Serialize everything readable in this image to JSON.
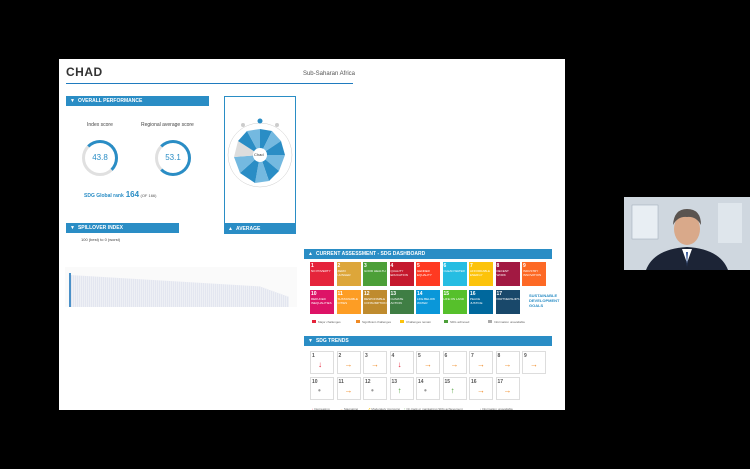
{
  "slide": {
    "country": "CHAD",
    "region": "Sub-Saharan Africa",
    "overall": {
      "header": "OVERALL PERFORMANCE",
      "index_label": "Index score",
      "index_value": "43.8",
      "index_fraction": 0.438,
      "regional_label": "Regional average score",
      "regional_value": "53.1",
      "regional_fraction": 0.531,
      "rank_label": "SDG Global rank",
      "rank_value": "164",
      "rank_of": "(OF 166)"
    },
    "radar": {
      "header": "AVERAGE PERFORMANCE BY SDG",
      "center": "Chad"
    },
    "spillover": {
      "header": "SPILLOVER INDEX",
      "subtitle": "100 (best) to 0 (worst)"
    },
    "dashboard": {
      "header": "CURRENT ASSESSMENT - SDG DASHBOARD",
      "tiles": [
        {
          "n": "1",
          "name": "NO POVERTY",
          "color": "#e5243b"
        },
        {
          "n": "2",
          "name": "ZERO HUNGER",
          "color": "#dda63a"
        },
        {
          "n": "3",
          "name": "GOOD HEALTH",
          "color": "#4c9f38"
        },
        {
          "n": "4",
          "name": "QUALITY EDUCATION",
          "color": "#c5192d"
        },
        {
          "n": "5",
          "name": "GENDER EQUALITY",
          "color": "#ff3a21"
        },
        {
          "n": "6",
          "name": "CLEAN WATER",
          "color": "#26bde2"
        },
        {
          "n": "7",
          "name": "AFFORDABLE ENERGY",
          "color": "#fcc30b"
        },
        {
          "n": "8",
          "name": "DECENT WORK",
          "color": "#a21942"
        },
        {
          "n": "9",
          "name": "INDUSTRY INNOVATION",
          "color": "#fd6925"
        },
        {
          "n": "10",
          "name": "REDUCED INEQUALITIES",
          "color": "#dd1367"
        },
        {
          "n": "11",
          "name": "SUSTAINABLE CITIES",
          "color": "#fd9d24"
        },
        {
          "n": "12",
          "name": "RESPONSIBLE CONSUMPTION",
          "color": "#bf8b2e"
        },
        {
          "n": "13",
          "name": "CLIMATE ACTION",
          "color": "#3f7e44"
        },
        {
          "n": "14",
          "name": "LIFE BELOW WATER",
          "color": "#0a97d9"
        },
        {
          "n": "15",
          "name": "LIFE ON LAND",
          "color": "#56c02b"
        },
        {
          "n": "16",
          "name": "PEACE JUSTICE",
          "color": "#00689d"
        },
        {
          "n": "17",
          "name": "PARTNERSHIPS",
          "color": "#19486a"
        }
      ],
      "goals_logo": "SUSTAINABLE DEVELOPMENT GOALS",
      "legend": [
        "Major challenges",
        "Significant challenges",
        "Challenges remain",
        "SDG achieved",
        "Information unavailable"
      ]
    },
    "trends": {
      "header": "SDG TRENDS",
      "items": [
        {
          "n": "1",
          "arrow": "↓",
          "color": "#e5243b"
        },
        {
          "n": "2",
          "arrow": "→",
          "color": "#f08a24"
        },
        {
          "n": "3",
          "arrow": "→",
          "color": "#f08a24"
        },
        {
          "n": "4",
          "arrow": "↓",
          "color": "#e5243b"
        },
        {
          "n": "5",
          "arrow": "→",
          "color": "#f08a24"
        },
        {
          "n": "6",
          "arrow": "→",
          "color": "#f08a24"
        },
        {
          "n": "7",
          "arrow": "→",
          "color": "#f08a24"
        },
        {
          "n": "8",
          "arrow": "→",
          "color": "#f08a24"
        },
        {
          "n": "9",
          "arrow": "→",
          "color": "#f08a24"
        },
        {
          "n": "10",
          "arrow": "•",
          "color": "#999999"
        },
        {
          "n": "11",
          "arrow": "→",
          "color": "#f08a24"
        },
        {
          "n": "12",
          "arrow": "•",
          "color": "#999999"
        },
        {
          "n": "13",
          "arrow": "↑",
          "color": "#4c9f38"
        },
        {
          "n": "14",
          "arrow": "•",
          "color": "#999999"
        },
        {
          "n": "15",
          "arrow": "↑",
          "color": "#4c9f38"
        },
        {
          "n": "16",
          "arrow": "→",
          "color": "#f08a24"
        },
        {
          "n": "17",
          "arrow": "→",
          "color": "#f08a24"
        }
      ],
      "legend": [
        "Decreasing",
        "Stagnating",
        "Moderately improving",
        "On track or maintaining SDG achievement",
        "Information unavailable"
      ]
    }
  }
}
